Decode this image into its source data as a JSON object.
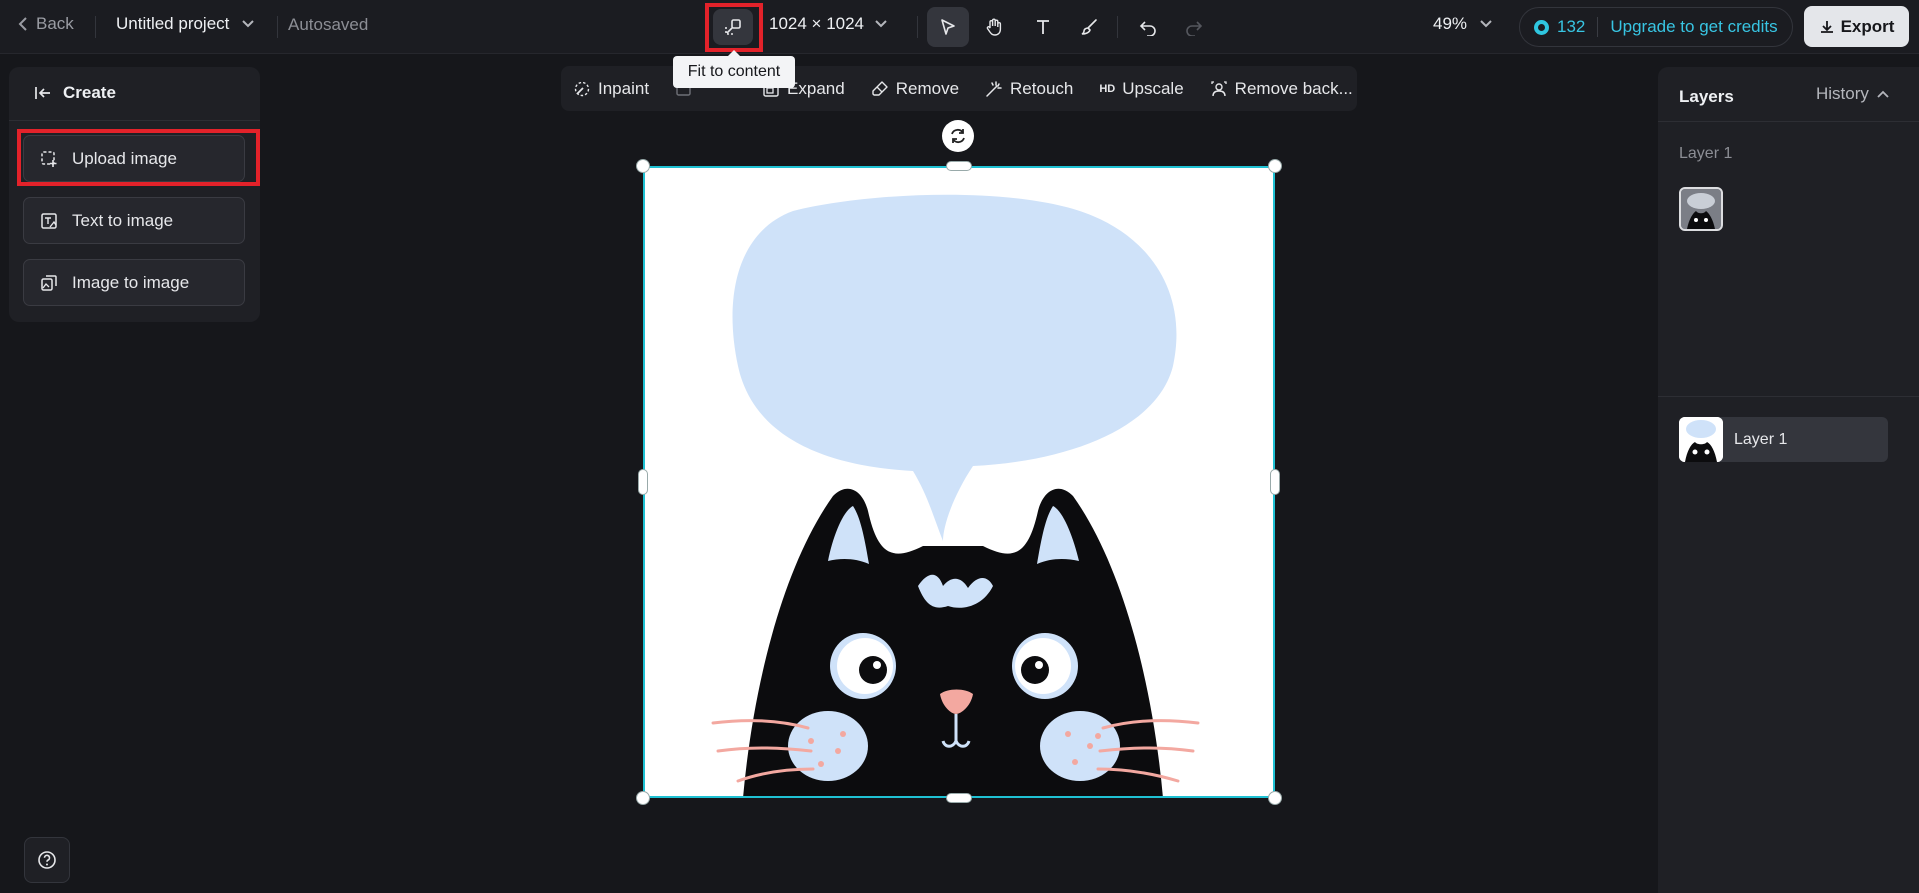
{
  "header": {
    "back_label": "Back",
    "project_title": "Untitled project",
    "save_status": "Autosaved",
    "canvas_size": "1024 × 1024",
    "zoom": "49%",
    "credits_count": "132",
    "upgrade_label": "Upgrade to get credits",
    "export_label": "Export"
  },
  "tooltip": {
    "text": "Fit to content"
  },
  "create_panel": {
    "title": "Create",
    "items": [
      {
        "label": "Upload image",
        "icon": "upload-image-icon"
      },
      {
        "label": "Text to image",
        "icon": "text-to-image-icon"
      },
      {
        "label": "Image to image",
        "icon": "image-to-image-icon"
      }
    ]
  },
  "edit_toolbar": {
    "items": [
      {
        "label": "Inpaint",
        "icon": "inpaint-icon"
      },
      {
        "label": "",
        "icon": "erase-icon"
      },
      {
        "label": "Expand",
        "icon": "expand-icon"
      },
      {
        "label": "Remove",
        "icon": "eraser-icon"
      },
      {
        "label": "Retouch",
        "icon": "magic-wand-icon"
      },
      {
        "label": "Upscale",
        "icon": "hd-icon",
        "icon_text": "HD"
      },
      {
        "label": "Remove back...",
        "icon": "person-remove-bg-icon"
      }
    ]
  },
  "layers_panel": {
    "title": "Layers",
    "history_label": "History",
    "group_label": "Layer 1",
    "layers": [
      {
        "name": "Layer 1"
      }
    ]
  },
  "colors": {
    "accent": "#38c5e3",
    "selection": "#1fc1d3",
    "highlight_box": "#e3222a",
    "bubble": "#cfe2f9"
  }
}
